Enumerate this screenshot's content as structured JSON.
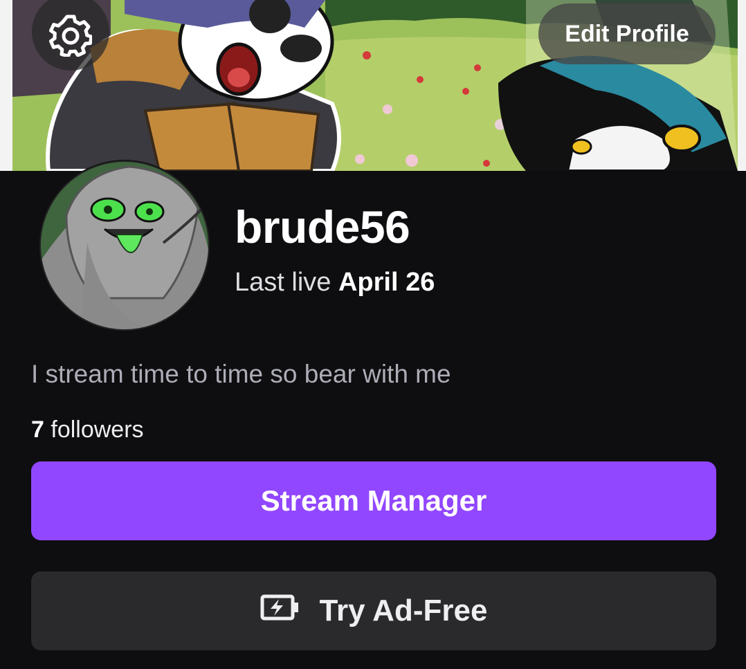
{
  "header": {
    "settings_icon": "gear-icon",
    "edit_profile_label": "Edit Profile"
  },
  "profile": {
    "username": "brude56",
    "last_live_prefix": "Last live",
    "last_live_date": "April 26",
    "bio": "I stream time to time so bear with me",
    "followers_count": "7",
    "followers_label": "followers"
  },
  "actions": {
    "stream_manager_label": "Stream Manager",
    "ad_free_label": "Try Ad-Free",
    "ad_free_icon": "battery-bolt-icon"
  },
  "colors": {
    "background": "#0e0e10",
    "accent": "#9147ff",
    "secondary_button": "#2a2a2d"
  }
}
